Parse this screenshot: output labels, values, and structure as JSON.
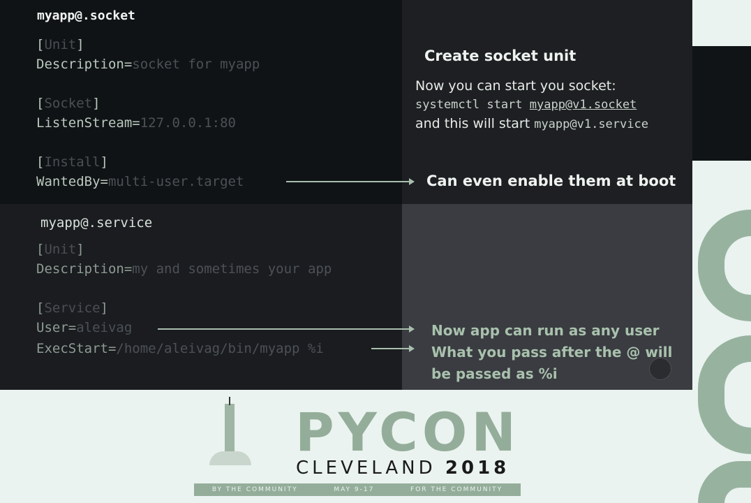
{
  "socket_unit": {
    "filename": "myapp@.socket",
    "lines": [
      {
        "section": "Unit"
      },
      {
        "key": "Description=",
        "value": "socket for myapp"
      },
      {
        "section": "Socket"
      },
      {
        "key": "ListenStream=",
        "value": "127.0.0.1:80"
      },
      {
        "section": "Install"
      },
      {
        "key": "WantedBy=",
        "value": "multi-user.target"
      }
    ]
  },
  "socket_notes": {
    "heading": "Create socket unit",
    "line1": "Now you can start you socket:",
    "cmd": "systemctl start ",
    "cmd_link": "myapp@v1.socket",
    "line3": "and this will start ",
    "line3_code": "myapp@v1.service",
    "boot_note": "Can even enable them at boot"
  },
  "service_unit": {
    "filename": "myapp@.service",
    "lines": [
      {
        "section": "Unit"
      },
      {
        "key": "Description=",
        "value": "my and sometimes your app"
      },
      {
        "section": "Service"
      },
      {
        "key": "User=",
        "value": "aleivag"
      },
      {
        "key": "ExecStart=",
        "value": "/home/aleivag/bin/myapp %i"
      }
    ]
  },
  "service_notes": {
    "user_note": "Now app can run as any user",
    "arg_note_1": "What you pass after the @ will",
    "arg_note_2": "be passed as %i"
  },
  "branding": {
    "logo_text": "PYCON",
    "city": "CLEVELAND",
    "year": "2018",
    "band_left": "BY THE COMMUNITY",
    "band_mid": "MAY 9-17",
    "band_right": "FOR THE COMMUNITY",
    "accent": "#94ad9a"
  }
}
